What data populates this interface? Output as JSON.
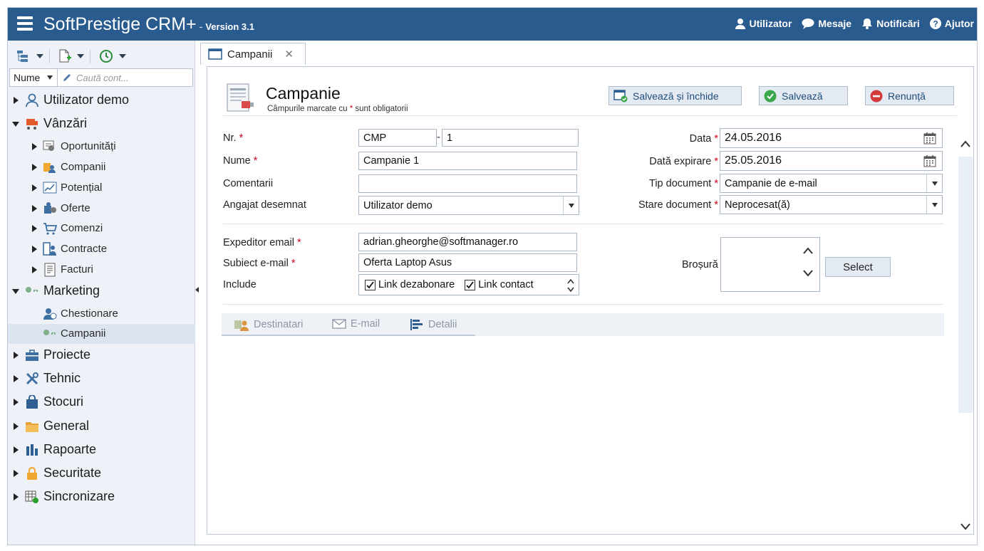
{
  "header": {
    "app_title": "SoftPrestige CRM+",
    "dash": "-",
    "version": "Version 3.1",
    "links": [
      {
        "label": "Utilizator",
        "icon": "user-icon"
      },
      {
        "label": "Mesaje",
        "icon": "chat-bubble-icon"
      },
      {
        "label": "Notificări",
        "icon": "bell-icon"
      },
      {
        "label": "Ajutor",
        "icon": "help-icon"
      }
    ]
  },
  "sidebar": {
    "search_field": "Nume",
    "search_placeholder": "Caută cont...",
    "items": [
      {
        "label": "Utilizator demo",
        "level": 1,
        "expanded": null,
        "icon": "user-icon"
      },
      {
        "label": "Vânzări",
        "level": 1,
        "expanded": true,
        "icon": "cart-icon"
      },
      {
        "label": "Oportunități",
        "level": 2,
        "expanded": false,
        "icon": "opportunity-icon"
      },
      {
        "label": "Companii",
        "level": 2,
        "expanded": false,
        "icon": "companies-icon"
      },
      {
        "label": "Potențial",
        "level": 2,
        "expanded": false,
        "icon": "chart-icon"
      },
      {
        "label": "Oferte",
        "level": 2,
        "expanded": false,
        "icon": "offers-icon"
      },
      {
        "label": "Comenzi",
        "level": 2,
        "expanded": false,
        "icon": "shopping-cart-icon"
      },
      {
        "label": "Contracte",
        "level": 2,
        "expanded": false,
        "icon": "contracts-icon"
      },
      {
        "label": "Facturi",
        "level": 2,
        "expanded": false,
        "icon": "invoice-icon"
      },
      {
        "label": "Marketing",
        "level": 1,
        "expanded": true,
        "icon": "keys-icon"
      },
      {
        "label": "Chestionare",
        "level": 2,
        "expanded": null,
        "icon": "survey-icon"
      },
      {
        "label": "Campanii",
        "level": 2,
        "expanded": null,
        "icon": "campaign-icon",
        "selected": true
      },
      {
        "label": "Proiecte",
        "level": 1,
        "expanded": false,
        "icon": "briefcase-icon"
      },
      {
        "label": "Tehnic",
        "level": 1,
        "expanded": false,
        "icon": "tools-icon"
      },
      {
        "label": "Stocuri",
        "level": 1,
        "expanded": false,
        "icon": "bag-icon"
      },
      {
        "label": "General",
        "level": 1,
        "expanded": false,
        "icon": "folder-icon"
      },
      {
        "label": "Rapoarte",
        "level": 1,
        "expanded": false,
        "icon": "bar-chart-icon"
      },
      {
        "label": "Securitate",
        "level": 1,
        "expanded": false,
        "icon": "lock-icon"
      },
      {
        "label": "Sincronizare",
        "level": 1,
        "expanded": false,
        "icon": "sync-icon"
      }
    ]
  },
  "tabs": [
    {
      "label": "Campanii",
      "close": "✕"
    }
  ],
  "form": {
    "title": "Campanie",
    "subtitle_pre": "Câmpurile marcate cu ",
    "subtitle_star": "*",
    "subtitle_post": " sunt obligatorii",
    "buttons": {
      "save_close": "Salvează și închide",
      "save": "Salvează",
      "cancel": "Renunță"
    },
    "fields": {
      "nr_label": "Nr.",
      "nr_prefix": "CMP",
      "nr_sep": "-",
      "nr_value": "1",
      "nume_label": "Nume",
      "nume_value": "Campanie 1",
      "comentarii_label": "Comentarii",
      "comentarii_value": "",
      "angajat_label": "Angajat desemnat",
      "angajat_value": "Utilizator demo",
      "data_label": "Data",
      "data_value": "24.05.2016",
      "expirare_label": "Dată expirare",
      "expirare_value": "25.05.2016",
      "tip_label": "Tip document",
      "tip_value": "Campanie de e-mail",
      "stare_label": "Stare document",
      "stare_value": "Neprocesat(ă)",
      "expeditor_label": "Expeditor email",
      "expeditor_value": "adrian.gheorghe@softmanager.ro",
      "subiect_label": "Subiect e-mail",
      "subiect_value": "Oferta Laptop Asus",
      "include_label": "Include",
      "include_options": [
        {
          "label": "Link dezabonare",
          "checked": true
        },
        {
          "label": "Link contact",
          "checked": true
        }
      ],
      "brosura_label": "Broșură",
      "select_label": "Select",
      "required_mark": "*"
    },
    "subtabs": [
      {
        "label": "Destinatari",
        "icon": "recipients-icon"
      },
      {
        "label": "E-mail",
        "icon": "envelope-icon"
      },
      {
        "label": "Detalii",
        "icon": "details-icon"
      }
    ]
  },
  "colors": {
    "header_bg": "#2a5b8e",
    "sidebar_bg": "#eef2f8",
    "required": "#d0021b",
    "button_bg": "#e3eaf2"
  }
}
